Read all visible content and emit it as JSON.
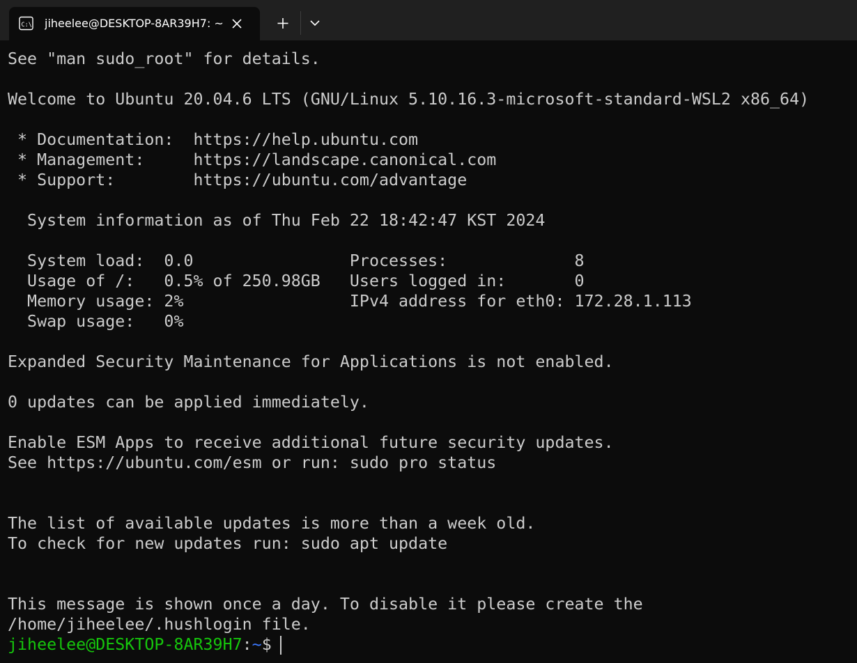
{
  "tab": {
    "title": "jiheelee@DESKTOP-8AR39H7: ~",
    "icon": "terminal-icon"
  },
  "colors": {
    "background": "#0c0c0c",
    "titlebar": "#202020",
    "text": "#cccccc",
    "prompt_user": "#16c60c",
    "prompt_path": "#3b78ff"
  },
  "terminal": {
    "lines": [
      "See \"man sudo_root\" for details.",
      "",
      "Welcome to Ubuntu 20.04.6 LTS (GNU/Linux 5.10.16.3-microsoft-standard-WSL2 x86_64)",
      "",
      " * Documentation:  https://help.ubuntu.com",
      " * Management:     https://landscape.canonical.com",
      " * Support:        https://ubuntu.com/advantage",
      "",
      "  System information as of Thu Feb 22 18:42:47 KST 2024",
      "",
      "  System load:  0.0                Processes:             8",
      "  Usage of /:   0.5% of 250.98GB   Users logged in:       0",
      "  Memory usage: 2%                 IPv4 address for eth0: 172.28.1.113",
      "  Swap usage:   0%",
      "",
      "Expanded Security Maintenance for Applications is not enabled.",
      "",
      "0 updates can be applied immediately.",
      "",
      "Enable ESM Apps to receive additional future security updates.",
      "See https://ubuntu.com/esm or run: sudo pro status",
      "",
      "",
      "The list of available updates is more than a week old.",
      "To check for new updates run: sudo apt update",
      "",
      "",
      "This message is shown once a day. To disable it please create the",
      "/home/jiheelee/.hushlogin file."
    ],
    "prompt": {
      "user_host": "jiheelee@DESKTOP-8AR39H7",
      "separator": ":",
      "path": "~",
      "symbol": "$"
    }
  }
}
